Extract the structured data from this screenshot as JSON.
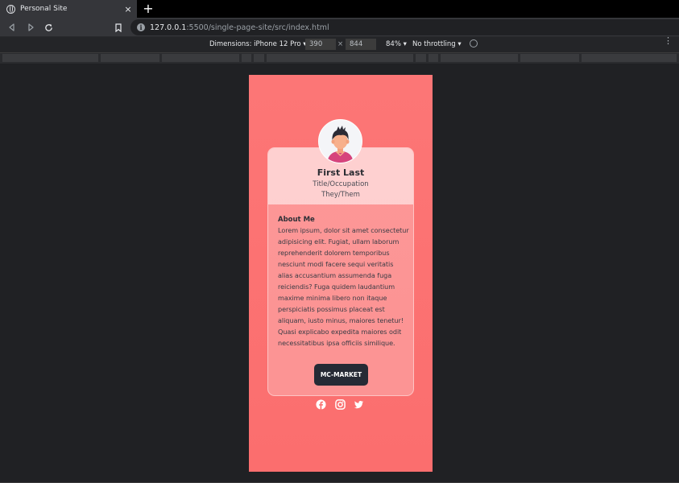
{
  "browser": {
    "tab_title": "Personal Site",
    "tab_close": "×",
    "new_tab": "+",
    "url_host": "127.0.0.1",
    "url_rest": ":5500/single-page-site/src/index.html"
  },
  "device_toolbar": {
    "dimensions_label": "Dimensions: iPhone 12 Pro ▾",
    "width": "390",
    "times": "×",
    "height": "844",
    "zoom": "84% ▾",
    "throttling": "No throttling ▾",
    "more": "⋮"
  },
  "page": {
    "name": "First Last",
    "title": "Title/Occupation",
    "pronouns": "They/Them",
    "about_heading": "About Me",
    "about_text": "Lorem ipsum, dolor sit amet consectetur adipisicing elit. Fugiat, ullam laborum reprehenderit dolorem temporibus nesciunt modi facere sequi veritatis alias accusantium assumenda fuga reiciendis? Fuga quidem laudantium maxime minima libero non itaque perspiciatis possimus placeat est aliquam, iusto minus, maiores tenetur! Quasi explicabo expedita maiores odit necessitatibus ipsa officiis similique.",
    "button_label": "MC-MARKET",
    "socials": [
      "facebook-icon",
      "instagram-icon",
      "twitter-icon"
    ]
  },
  "colors": {
    "page_background": "#fc7676",
    "button": "#262a35",
    "devtools_bg": "#202124"
  }
}
